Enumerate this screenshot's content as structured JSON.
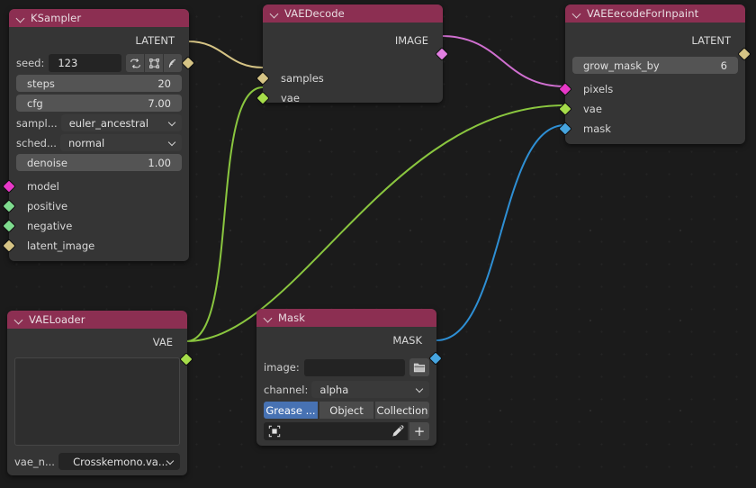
{
  "editor": {
    "background": "#1b1b1b",
    "grid_dot_color": "#2c2c2c"
  },
  "socket_colors": {
    "LATENT": "#d6c485",
    "IMAGE": "#e27fe2",
    "VAE": "#a6dd4a",
    "MASK": "#46a5e0",
    "MODEL": "#e838c8",
    "CONDITIONING": "#7fdc8f"
  },
  "nodes": {
    "ksampler": {
      "title": "KSampler",
      "header_color": "#8c2f52",
      "outputs": [
        {
          "label": "LATENT",
          "type": "LATENT"
        }
      ],
      "seed": {
        "label": "seed:",
        "value": "123",
        "buttons": [
          "randomize-icon",
          "nodes-icon",
          "signal-icon"
        ]
      },
      "widgets": [
        {
          "kind": "slider",
          "label": "steps",
          "value": "20"
        },
        {
          "kind": "slider",
          "label": "cfg",
          "value": "7.00"
        },
        {
          "kind": "combo",
          "label": "sampl...",
          "value": "euler_ancestral"
        },
        {
          "kind": "combo",
          "label": "sched...",
          "value": "normal"
        },
        {
          "kind": "slider",
          "label": "denoise",
          "value": "1.00"
        }
      ],
      "inputs": [
        {
          "label": "model",
          "type": "MODEL"
        },
        {
          "label": "positive",
          "type": "CONDITIONING"
        },
        {
          "label": "negative",
          "type": "CONDITIONING"
        },
        {
          "label": "latent_image",
          "type": "LATENT"
        }
      ]
    },
    "vaedecode": {
      "title": "VAEDecode",
      "header_color": "#8c2f52",
      "outputs": [
        {
          "label": "IMAGE",
          "type": "IMAGE"
        }
      ],
      "inputs": [
        {
          "label": "samples",
          "type": "LATENT"
        },
        {
          "label": "vae",
          "type": "VAE"
        }
      ]
    },
    "vaeencodeinpaint": {
      "title": "VAEEecodeForInpaint",
      "header_color": "#8c2f52",
      "outputs": [
        {
          "label": "LATENT",
          "type": "LATENT"
        }
      ],
      "widgets": [
        {
          "kind": "slider",
          "label": "grow_mask_by",
          "value": "6"
        }
      ],
      "inputs": [
        {
          "label": "pixels",
          "type": "IMAGE"
        },
        {
          "label": "vae",
          "type": "VAE"
        },
        {
          "label": "mask",
          "type": "MASK"
        }
      ]
    },
    "vaeloader": {
      "title": "VAELoader",
      "header_color": "#8c2f52",
      "outputs": [
        {
          "label": "VAE",
          "type": "VAE"
        }
      ],
      "preview": "empty-preview",
      "combo": {
        "label": "vae_n...",
        "value": "Crosskemono.va..."
      }
    },
    "mask": {
      "title": "Mask",
      "header_color": "#8c2f52",
      "outputs": [
        {
          "label": "MASK",
          "type": "MASK"
        }
      ],
      "image_row": {
        "label": "image:",
        "value": "",
        "button_icon": "folder-icon"
      },
      "channel_row": {
        "label": "channel:",
        "value": "alpha"
      },
      "segments": [
        {
          "label": "Grease ...",
          "active": true
        },
        {
          "label": "Object",
          "active": false
        },
        {
          "label": "Collection",
          "active": false
        }
      ],
      "picker_row": {
        "swatch_icon": "bbox-icon",
        "eyedropper_icon": "eyedropper-icon",
        "plus_label": "+"
      }
    }
  }
}
